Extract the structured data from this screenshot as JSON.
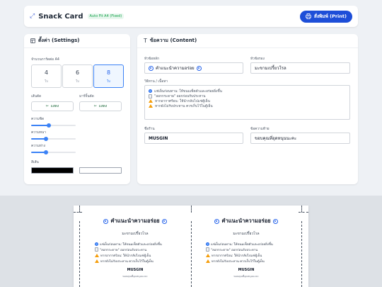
{
  "app": {
    "title": "Snack Card",
    "badge": "Auto Fit A4 (Fixed)",
    "print_label": "สั่งพิมพ์ (Print)"
  },
  "settings": {
    "title": "ตั้งค่า (Settings)",
    "count_label": "จำนวนการ์ดต่อ A4",
    "counts": [
      {
        "n": "4",
        "unit": "ใบ"
      },
      {
        "n": "6",
        "unit": "ใบ"
      },
      {
        "n": "8",
        "unit": "ใบ"
      }
    ],
    "selected_count": "8",
    "cut_line_label": "เส้นตัด",
    "cut_line_value": "แสดง",
    "card_border_label": "มาร์จิ้นตัด",
    "card_border_value": "แสดง",
    "slider1_label": "ความชิด",
    "slider1_level": 0.4,
    "slider2_label": "ความหนา",
    "slider2_level": 0.33,
    "slider3_label": "ความห่าง",
    "slider3_level": 0.33,
    "color_label": "สีเส้น",
    "color_dark": "#000000",
    "color_light": "#ffffff"
  },
  "content": {
    "title": "ข้อความ (Content)",
    "heading_label": "หัวข้อหลัก",
    "heading_value": "คำแนะนำความอร่อย",
    "subheading_label": "หัวข้อรอง",
    "subheading_value": "มะขามเปรี้ยวโรล",
    "details_label": "วิธีทาน / เนื้อหา",
    "lines": [
      {
        "icon": "swirl-icon",
        "text": "แช่เย็นก่อนทาน: ให้ขนมเซ็ตตัวและอร่อยยิ่งขึ้น"
      },
      {
        "icon": "document-icon",
        "text": "\"ลอกกระดาษ\" ออกก่อนรับประทาน"
      },
      {
        "icon": "warning-icon",
        "text": "หากอากาศร้อน: ให้นำกลับไปแช่ตู้เย็น"
      },
      {
        "icon": "warning-icon",
        "text": "หากยังไม่รับประทาน ควรเก็บไว้ในตู้เย็น"
      }
    ],
    "shop_label": "ชื่อร้าน",
    "shop_value": "MUSGIN",
    "footer_label": "ข้อความท้าย",
    "footer_value": "ขอบคุณที่อุดหนุนนะคะ"
  },
  "preview": {
    "cards": [
      {
        "title": "คำแนะนำความอร่อย",
        "subtitle": "มะขามเปรี้ยวโรล",
        "lines": [
          {
            "icon": "star-icon",
            "text": "แช่เย็นก่อนทาน: ให้ขนมเซ็ตตัวและอร่อยยิ่งขึ้น"
          },
          {
            "icon": "document-icon",
            "text": "\"ลอกกระดาษ\" ออกก่อนรับประทาน"
          },
          {
            "icon": "warning-icon",
            "text": "หากอากาศร้อน: ให้นำกลับไปแช่ตู้เย็น"
          },
          {
            "icon": "warning-icon",
            "text": "หากยังไม่รับประทาน ควรเก็บไว้ในตู้เย็น"
          }
        ],
        "shop": "MUSGIN",
        "thanks": "ขอบคุณที่อุดหนุนนะคะ"
      },
      {
        "title": "คำแนะนำความอร่อย",
        "subtitle": "มะขามเปรี้ยวโรล",
        "lines": [
          {
            "icon": "star-icon",
            "text": "แช่เย็นก่อนทาน: ให้ขนมเซ็ตตัวและอร่อยยิ่งขึ้น"
          },
          {
            "icon": "document-icon",
            "text": "\"ลอกกระดาษ\" ออกก่อนรับประทาน"
          },
          {
            "icon": "warning-icon",
            "text": "หากอากาศร้อน: ให้นำกลับไปแช่ตู้เย็น"
          },
          {
            "icon": "warning-icon",
            "text": "หากยังไม่รับประทาน ควรเก็บไว้ในตู้เย็น"
          }
        ],
        "shop": "MUSGIN",
        "thanks": "ขอบคุณที่อุดหนุนนะคะ"
      }
    ]
  },
  "colors": {
    "accent": "#1d4ed8",
    "badge_green": "#16a34a"
  }
}
